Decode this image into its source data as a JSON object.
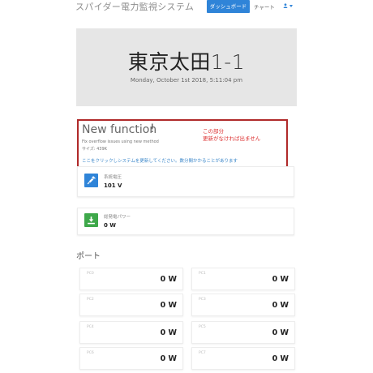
{
  "navbar": {
    "brand": "スパイダー電力監視システム",
    "dashboard_label": "ダッシュボード",
    "chart_label": "チャート",
    "user_icon": "user-icon",
    "accent_color": "#2f84d8"
  },
  "hero": {
    "title_kanji": "東京太田",
    "title_num": "1-1",
    "datetime": "Monday, October 1st 2018, 5:11:04 pm",
    "background": "#e6e6e6"
  },
  "notice": {
    "title": "New function",
    "bang": "!",
    "annotation_line1": "この部分",
    "annotation_line2": "更新がなければ出ません",
    "fix_text": "Fix overflow issues using new method",
    "size_text": "サイズ: 439K",
    "link_text": "ここをクリックしシステムを更新してください。数分間かかることがあります",
    "border_color": "#b02a2a"
  },
  "metrics": [
    {
      "label": "系統電圧",
      "value": "101 V",
      "icon": "plug-icon",
      "color": "#2f84d8"
    },
    {
      "label": "総発電パワー",
      "value": "0 W",
      "icon": "download-icon",
      "color": "#3ea84a"
    }
  ],
  "ports_section": {
    "title": "ポート",
    "ports": [
      {
        "label": "PC0",
        "value": "0 W"
      },
      {
        "label": "PC1",
        "value": "0 W"
      },
      {
        "label": "PC2",
        "value": "0 W"
      },
      {
        "label": "PC3",
        "value": "0 W"
      },
      {
        "label": "PC4",
        "value": "0 W"
      },
      {
        "label": "PC5",
        "value": "0 W"
      },
      {
        "label": "PC6",
        "value": "0 W"
      },
      {
        "label": "PC7",
        "value": "0 W"
      }
    ]
  }
}
